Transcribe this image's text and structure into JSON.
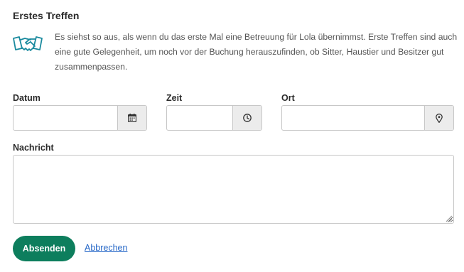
{
  "section": {
    "title": "Erstes Treffen",
    "icon": "handshake-icon",
    "info_text": "Es siehst so aus, als wenn du das erste Mal eine Betreuung für Lola übernimmst. Erste Treffen sind auch eine gute Gelegenheit, um noch vor der Buchung herauszufinden, ob Sitter, Haustier und Besitzer gut zusammenpassen."
  },
  "fields": {
    "date": {
      "label": "Datum",
      "value": "",
      "icon": "calendar-icon"
    },
    "time": {
      "label": "Zeit",
      "value": "",
      "icon": "clock-icon"
    },
    "place": {
      "label": "Ort",
      "value": "",
      "icon": "location-pin-icon"
    },
    "message": {
      "label": "Nachricht",
      "value": ""
    }
  },
  "actions": {
    "submit_label": "Absenden",
    "cancel_label": "Abbrechen"
  },
  "colors": {
    "accent": "#0d7e5d",
    "link": "#2466c7",
    "icon_teal": "#1a8a9e"
  }
}
